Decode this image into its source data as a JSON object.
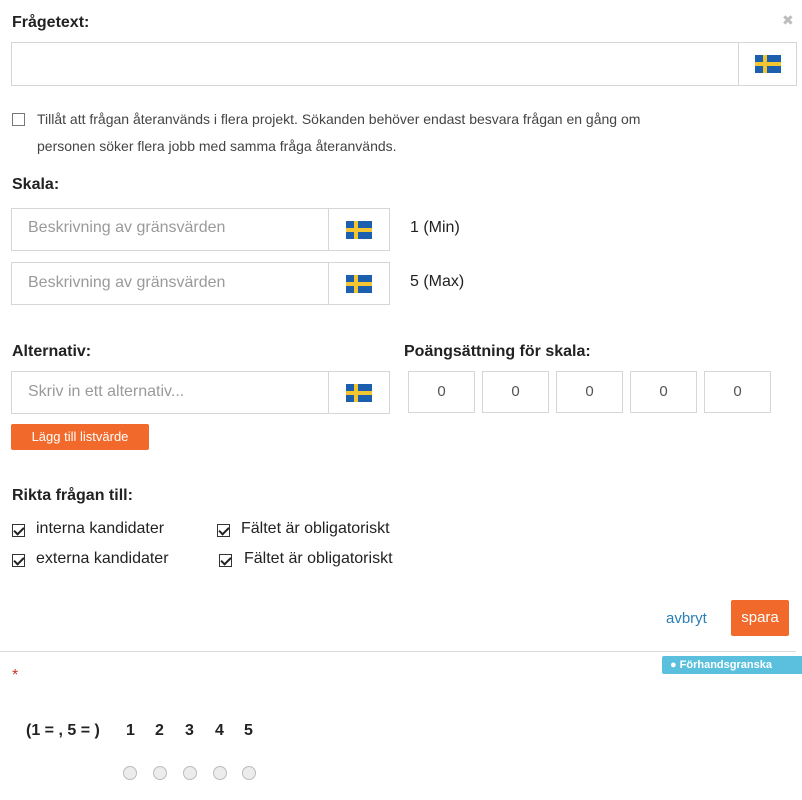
{
  "question": {
    "label": "Frågetext:",
    "close_glyph": "✖"
  },
  "reuse": {
    "line1": "Tillåt att frågan återanvänds i flera projekt. Sökanden behöver endast besvara frågan en gång om",
    "line2": "personen söker flera jobb med samma fråga återanvänds.",
    "checked": false
  },
  "scale": {
    "label": "Skala:",
    "min_placeholder": "Beskrivning av gränsvärden",
    "min_label": "1 (Min)",
    "max_placeholder": "Beskrivning av gränsvärden",
    "max_label": "5 (Max)"
  },
  "alternatives": {
    "label": "Alternativ:",
    "placeholder": "Skriv in ett alternativ...",
    "add_button": "Lägg till listvärde"
  },
  "scoring": {
    "label": "Poängsättning för skala:",
    "values": [
      "0",
      "0",
      "0",
      "0",
      "0"
    ]
  },
  "target": {
    "label": "Rikta frågan till:",
    "internal": "interna kandidater",
    "internal_required": "Fältet är obligatoriskt",
    "external": "externa kandidater",
    "external_required": "Fältet är obligatoriskt"
  },
  "actions": {
    "cancel": "avbryt",
    "save": "spara"
  },
  "preview": {
    "badge": "Förhandsgranska",
    "required_marker": "*",
    "scale_text": "(1 = , 5 = )",
    "numbers": [
      "1",
      "2",
      "3",
      "4",
      "5"
    ]
  },
  "colors": {
    "accent": "#f26a2b",
    "link": "#2a7fb8",
    "preview_badge": "#5bc0de"
  }
}
